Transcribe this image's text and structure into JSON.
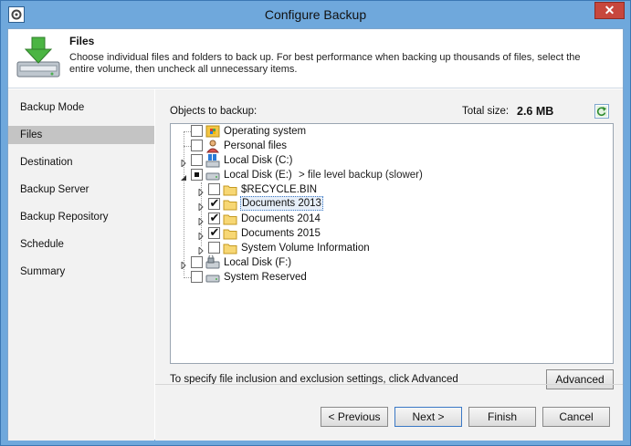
{
  "window": {
    "title": "Configure Backup",
    "close_label": "✕"
  },
  "header": {
    "title": "Files",
    "description": "Choose individual files and folders to back up. For best performance when backing up thousands of files, select the entire volume, then uncheck all unnecessary items."
  },
  "sidebar": {
    "items": [
      {
        "label": "Backup Mode"
      },
      {
        "label": "Files"
      },
      {
        "label": "Destination"
      },
      {
        "label": "Backup Server"
      },
      {
        "label": "Backup Repository"
      },
      {
        "label": "Schedule"
      },
      {
        "label": "Summary"
      }
    ],
    "active_index": 1
  },
  "main": {
    "objects_label": "Objects to backup:",
    "total_label": "Total size:",
    "total_value": "2.6 MB",
    "tree": [
      {
        "label": "Operating system",
        "state": "unchecked",
        "icon": "os-icon",
        "expander": "none"
      },
      {
        "label": "Personal files",
        "state": "unchecked",
        "icon": "user-icon",
        "expander": "none"
      },
      {
        "label": "Local Disk (C:)",
        "state": "unchecked",
        "icon": "windows-disk-icon",
        "expander": "collapsed"
      },
      {
        "label": "Local Disk (E:)",
        "state": "partial",
        "icon": "disk-icon",
        "expander": "expanded",
        "note": "> file level backup (slower)"
      },
      {
        "label": "$RECYCLE.BIN",
        "state": "unchecked",
        "icon": "folder-icon",
        "expander": "collapsed"
      },
      {
        "label": "Documents 2013",
        "state": "checked",
        "icon": "folder-icon",
        "expander": "collapsed",
        "highlighted": true
      },
      {
        "label": "Documents 2014",
        "state": "checked",
        "icon": "folder-icon",
        "expander": "collapsed"
      },
      {
        "label": "Documents 2015",
        "state": "checked",
        "icon": "folder-icon",
        "expander": "collapsed"
      },
      {
        "label": "System Volume Information",
        "state": "unchecked",
        "icon": "folder-icon",
        "expander": "collapsed"
      },
      {
        "label": "Local Disk (F:)",
        "state": "unchecked",
        "icon": "lock-disk-icon",
        "expander": "collapsed"
      },
      {
        "label": "System Reserved",
        "state": "unchecked",
        "icon": "disk-icon",
        "expander": "none"
      }
    ],
    "hint": "To specify file inclusion and exclusion settings, click Advanced",
    "advanced_label": "Advanced"
  },
  "footer": {
    "previous_label": "< Previous",
    "next_label": "Next >",
    "finish_label": "Finish",
    "cancel_label": "Cancel"
  }
}
